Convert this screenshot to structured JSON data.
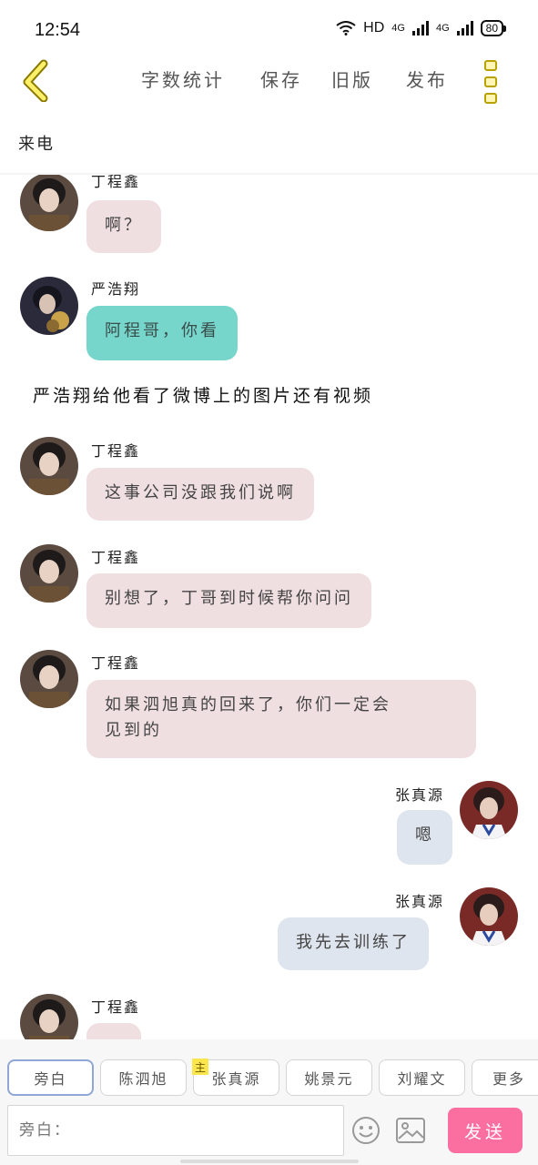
{
  "status": {
    "time": "12:54",
    "network": "HD",
    "sim1": "4G",
    "sim2": "4G",
    "battery": "80"
  },
  "toolbar": {
    "word_count": "字数统计",
    "save": "保存",
    "old_version": "旧版",
    "publish": "发布"
  },
  "scene_title": "来电",
  "chat": {
    "messages": [
      {
        "name": "丁程鑫",
        "text": "啊？"
      },
      {
        "name": "严浩翔",
        "text": "阿程哥，你看"
      },
      {
        "name": "丁程鑫",
        "text": "这事公司没跟我们说啊"
      },
      {
        "name": "丁程鑫",
        "text": "别想了，丁哥到时候帮你问问"
      },
      {
        "name": "丁程鑫",
        "text": "如果泗旭真的回来了，你们一定会",
        "text2": "见到的"
      },
      {
        "name": "张真源",
        "text": "嗯"
      },
      {
        "name": "张真源",
        "text": "我先去训练了"
      },
      {
        "name": "丁程鑫",
        "text": ""
      }
    ],
    "narration": "严浩翔给他看了微博上的图片还有视频"
  },
  "roles": [
    {
      "label": "旁白"
    },
    {
      "label": "陈泗旭"
    },
    {
      "label": "张真源",
      "badge": "主"
    },
    {
      "label": "姚景元"
    },
    {
      "label": "刘耀文"
    },
    {
      "label": "更多"
    }
  ],
  "input": {
    "placeholder": "旁白："
  },
  "send_label": "发送",
  "colors": {
    "pink_bubble": "#f0dfe0",
    "teal_bubble": "#77d6cb",
    "blue_bubble": "#dfe5ee",
    "send_button": "#fb6fa0",
    "accent_yellow": "#fbe64e"
  },
  "icons": {
    "back": "chevron-left-icon",
    "menu": "more-vertical-icon",
    "emoji": "smiley-icon",
    "image": "image-icon"
  }
}
